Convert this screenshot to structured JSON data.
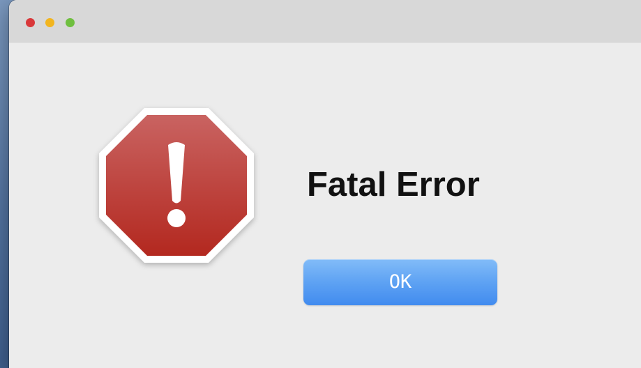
{
  "dialog": {
    "title": "Fatal Error",
    "ok_label": "OK",
    "icon": "stop-exclamation-icon"
  },
  "window": {
    "traffic_lights": [
      "close",
      "minimize",
      "zoom"
    ]
  },
  "colors": {
    "stop_red_top": "#c96361",
    "stop_red_bottom": "#b3281f",
    "button_blue_top": "#82bcf8",
    "button_blue_bottom": "#418bef",
    "close": "#d9383a",
    "minimize": "#f2b51f",
    "zoom": "#6fbf3f"
  }
}
